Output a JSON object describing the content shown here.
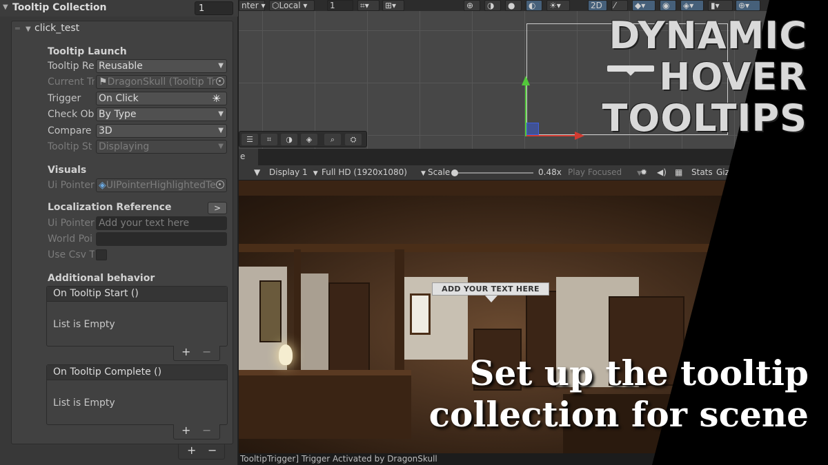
{
  "inspector": {
    "header_title": "Tooltip Collection",
    "collection_count": "1",
    "element_name": "click_test",
    "sections": {
      "tooltip_launch": "Tooltip Launch",
      "visuals": "Visuals",
      "localization": "Localization Reference",
      "additional": "Additional behavior"
    },
    "rows": {
      "tooltip_reuse_label": "Tooltip Re",
      "tooltip_reuse_value": "Reusable",
      "current_trigger_label": "Current Tr",
      "current_trigger_value": "DragonSkull (Tooltip Tr",
      "trigger_label": "Trigger",
      "trigger_value": "On Click",
      "check_object_label": "Check Ob",
      "check_object_value": "By Type",
      "compare_label": "Compare",
      "compare_value": "3D",
      "tooltip_state_label": "Tooltip St",
      "tooltip_state_value": "Displaying",
      "ui_pointer_label": "Ui Pointer",
      "ui_pointer_value": "UIPointerHighlightedTe",
      "loc_ui_pointer_label": "Ui Pointer",
      "loc_ui_pointer_placeholder": "Add your text here",
      "world_pointer_label": "World Poi",
      "use_csv_label": "Use Csv T",
      "localization_button": ">"
    },
    "events": [
      {
        "title": "On Tooltip Start ()",
        "empty": "List is Empty"
      },
      {
        "title": "On Tooltip Complete ()",
        "empty": "List is Empty"
      }
    ],
    "plus": "+",
    "minus": "−"
  },
  "scene_toolbar": {
    "pivot": "nter",
    "space": "Local",
    "snap_value": "1",
    "mode_2d": "2D"
  },
  "game_view": {
    "tab_label": "e",
    "display": "Display 1",
    "resolution": "Full HD (1920x1080)",
    "scale_label": "Scale",
    "scale_value": "0.48x",
    "play_mode": "Play Focused",
    "stats": "Stats",
    "gizmos": "Giz",
    "tooltip_text": "ADD YOUR TEXT HERE"
  },
  "status": "TooltipTrigger] Trigger Activated by DragonSkull",
  "overlay": {
    "headline_1": "DYNAMIC",
    "headline_2": "HOVER",
    "headline_3": "TOOLTIPS",
    "caption_1": "Set up the tooltip",
    "caption_2": "collection for scene"
  },
  "colors": {
    "panel": "#383838",
    "gizmo_y": "#52c83a",
    "gizmo_x": "#d23a30",
    "caption": "#ffffff",
    "headline": "#d9d9d9"
  }
}
